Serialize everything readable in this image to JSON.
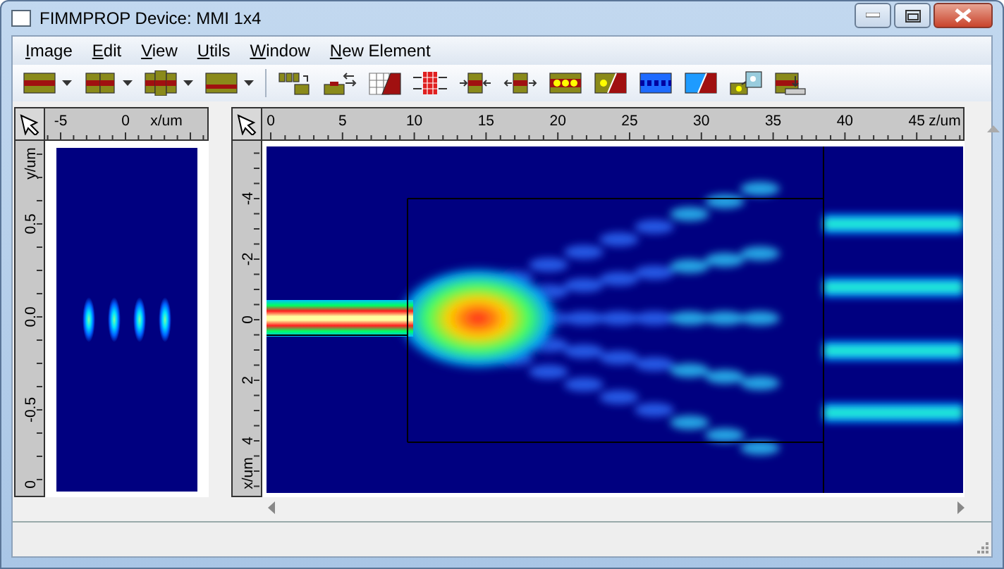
{
  "window": {
    "title": "FIMMPROP Device: MMI 1x4"
  },
  "menu": [
    {
      "accel": "I",
      "rest": "mage"
    },
    {
      "accel": "E",
      "rest": "dit"
    },
    {
      "accel": "V",
      "rest": "iew"
    },
    {
      "accel": "U",
      "rest": "tils"
    },
    {
      "accel": "W",
      "rest": "indow"
    },
    {
      "accel": "N",
      "rest": "ew Element"
    }
  ],
  "cross_section": {
    "h_ruler": {
      "labels": [
        "-5",
        "0"
      ],
      "unit": "x/um"
    },
    "v_ruler": {
      "labels": [
        "0.5",
        "0.0",
        "-0.5",
        "0"
      ],
      "unit": "y/um"
    }
  },
  "propagation": {
    "h_ruler": {
      "labels": [
        "0",
        "5",
        "10",
        "15",
        "20",
        "25",
        "30",
        "35",
        "40",
        "45"
      ],
      "unit": "z/um"
    },
    "v_ruler": {
      "labels": [
        "-4",
        "-2",
        "0",
        "2",
        "4"
      ],
      "unit": "x/um"
    }
  }
}
